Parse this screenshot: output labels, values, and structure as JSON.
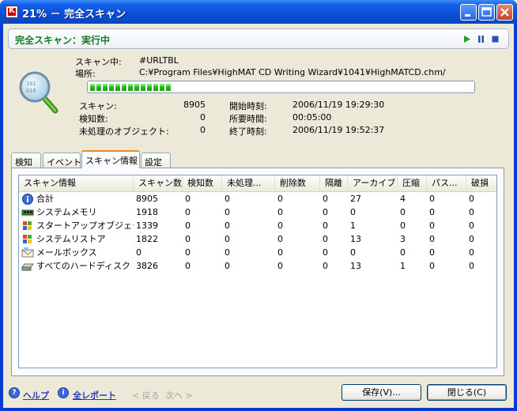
{
  "window": {
    "title": "21% － 完全スキャン"
  },
  "header": {
    "status_title": "完全スキャン：実行中"
  },
  "scan_info": {
    "scanning_label": "スキャン中:",
    "scanning_value": "#URLTBL",
    "location_label": "場所:",
    "location_value": "C:¥Program Files¥HighMAT CD Writing Wizard¥1041¥HighMATCD.chm/",
    "progress_percent": 21
  },
  "stats": {
    "scanned_label": "スキャン:",
    "scanned_value": "8905",
    "detected_label": "検知数:",
    "detected_value": "0",
    "unprocessed_label": "未処理のオブジェクト:",
    "unprocessed_value": "0",
    "start_label": "開始時刻:",
    "start_value": "2006/11/19 19:29:30",
    "elapsed_label": "所要時間:",
    "elapsed_value": "00:05:00",
    "end_label": "終了時刻:",
    "end_value": "2006/11/19 19:52:37"
  },
  "tabs": [
    {
      "label": "検知",
      "active": false
    },
    {
      "label": "イベント",
      "active": false
    },
    {
      "label": "スキャン情報",
      "active": true
    },
    {
      "label": "設定",
      "active": false
    }
  ],
  "table": {
    "columns": [
      "スキャン情報",
      "スキャン数",
      "検知数",
      "未処理...",
      "削除数",
      "隔離",
      "アーカイブ",
      "圧縮",
      "パス...",
      "破損"
    ],
    "rows": [
      {
        "icon": "info-icon",
        "cells": [
          "合計",
          "8905",
          "0",
          "0",
          "0",
          "0",
          "27",
          "4",
          "0",
          "0"
        ]
      },
      {
        "icon": "memory-chip-icon",
        "cells": [
          "システムメモリ",
          "1918",
          "0",
          "0",
          "0",
          "0",
          "0",
          "0",
          "0",
          "0"
        ]
      },
      {
        "icon": "windows-flag-icon",
        "cells": [
          "スタートアップオブジェクト",
          "1339",
          "0",
          "0",
          "0",
          "0",
          "1",
          "0",
          "0",
          "0"
        ]
      },
      {
        "icon": "windows-flag-icon",
        "cells": [
          "システムリストア",
          "1822",
          "0",
          "0",
          "0",
          "0",
          "13",
          "3",
          "0",
          "0"
        ]
      },
      {
        "icon": "mailbox-icon",
        "cells": [
          "メールボックス",
          "0",
          "0",
          "0",
          "0",
          "0",
          "0",
          "0",
          "0",
          "0"
        ]
      },
      {
        "icon": "hard-disk-icon",
        "cells": [
          "すべてのハードディスク",
          "3826",
          "0",
          "0",
          "0",
          "0",
          "13",
          "1",
          "0",
          "0"
        ]
      }
    ]
  },
  "footer": {
    "help": "ヘルプ",
    "full_report": "全レポート",
    "back": "< 戻る",
    "next": "次へ >",
    "save": "保存(V)...",
    "close": "閉じる(C)"
  }
}
